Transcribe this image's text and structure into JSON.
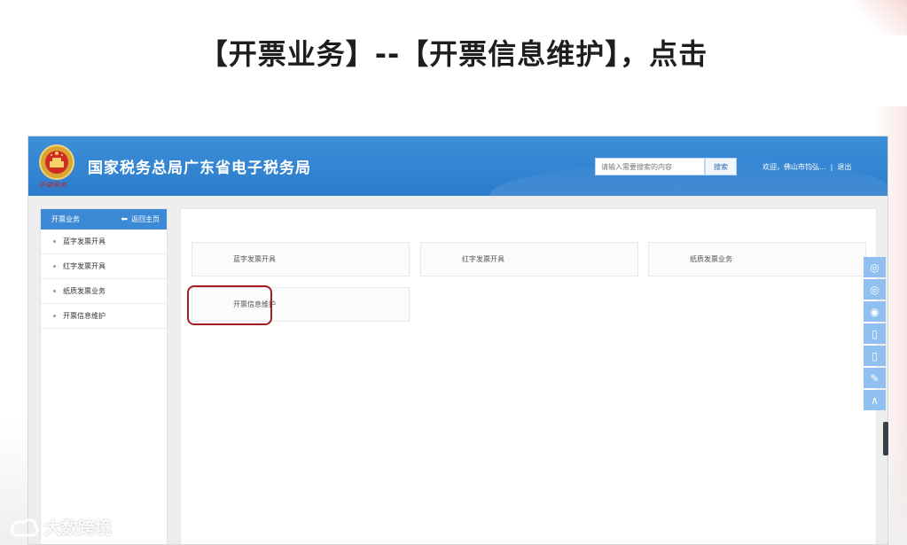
{
  "slide": {
    "title": "【开票业务】--【开票信息维护】，点击"
  },
  "header": {
    "title": "国家税务总局广东省电子税务局",
    "emblem_caption": "中国税务",
    "search_placeholder": "请输入需要搜索的内容",
    "search_button": "搜索",
    "welcome": "欢迎，佛山市钧弘...",
    "separator": "|",
    "logout": "退出"
  },
  "sidebar": {
    "heading": "开票业务",
    "back_home": "返回主页",
    "items": [
      {
        "label": "蓝字发票开具"
      },
      {
        "label": "红字发票开具"
      },
      {
        "label": "纸质发票业务"
      },
      {
        "label": "开票信息维护"
      }
    ]
  },
  "main": {
    "tiles": [
      {
        "label": "蓝字发票开具"
      },
      {
        "label": "红字发票开具"
      },
      {
        "label": "纸质发票业务"
      },
      {
        "label": "开票信息维护"
      }
    ]
  },
  "float_bar": {
    "icons": [
      "wechat-icon",
      "wechat-icon",
      "weibo-icon",
      "mobile-icon",
      "mobile-icon",
      "edit-icon",
      "back-to-top-icon"
    ]
  },
  "watermark": {
    "text": "大数跨境"
  },
  "colors": {
    "header_blue": "#2b7ccc",
    "sidebar_head_blue": "#3c8ad6",
    "highlight_red": "#a51c24"
  }
}
